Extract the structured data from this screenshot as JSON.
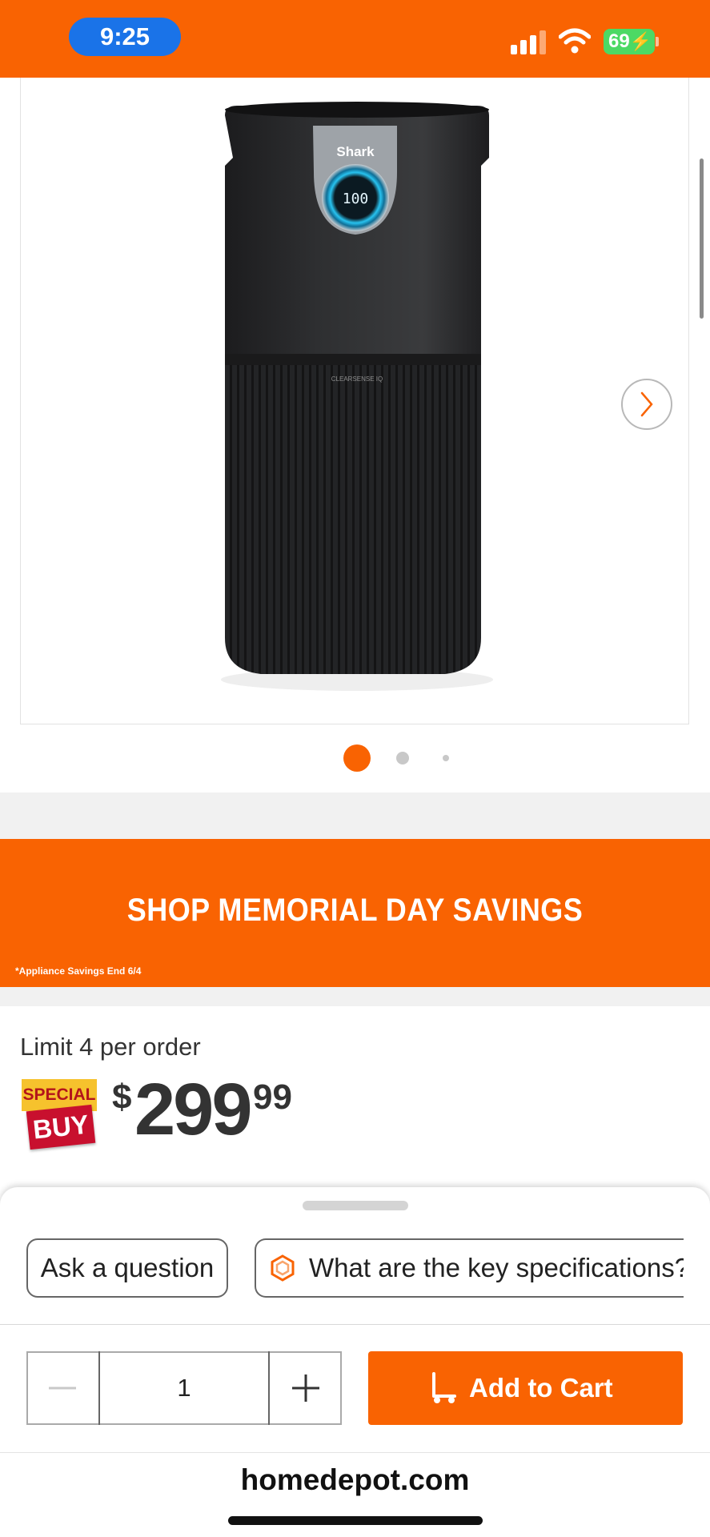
{
  "status_bar": {
    "time": "9:25",
    "battery": "69",
    "bg_color": "#f96302"
  },
  "product_image": {
    "brand_on_device": "Shark",
    "display_reading": "100",
    "model_text": "CLEARSENSE IQ",
    "carousel_total": 3,
    "carousel_current": 1
  },
  "promo": {
    "title": "SHOP MEMORIAL DAY SAVINGS",
    "note": "*Appliance Savings End 6/4"
  },
  "pricing": {
    "limit": "Limit 4 per order",
    "badge_top": "SPECIAL",
    "badge_bottom": "BUY",
    "currency": "$",
    "whole": "299",
    "cents": "99"
  },
  "assistant": {
    "chips": [
      {
        "label": "Ask a question"
      },
      {
        "label": "What are the key specifications?"
      }
    ]
  },
  "purchase": {
    "quantity": "1",
    "add_to_cart": "Add to Cart"
  },
  "browser": {
    "url": "homedepot.com"
  },
  "colors": {
    "brand_orange": "#f96302",
    "special_yellow": "#f6c22d",
    "special_red": "#c8102e"
  }
}
